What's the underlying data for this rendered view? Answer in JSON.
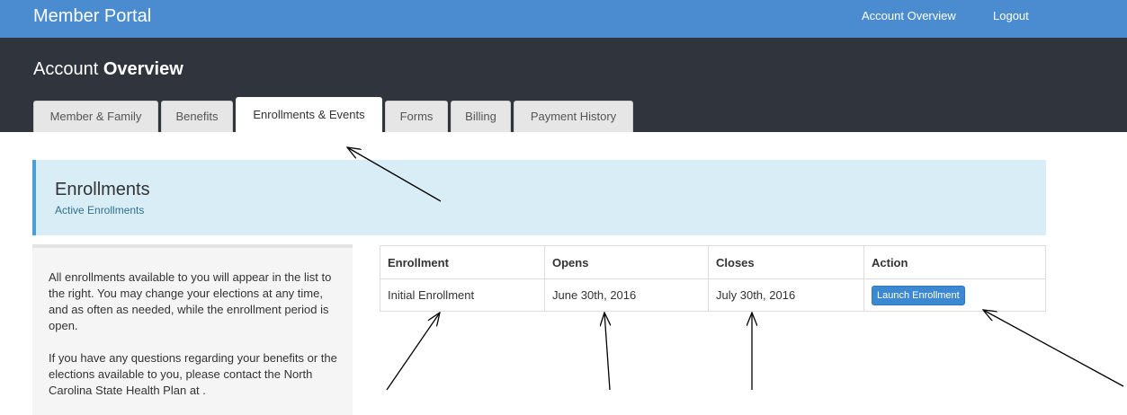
{
  "navbar": {
    "brand": "Member Portal",
    "links": [
      {
        "label": "Account Overview"
      },
      {
        "label": "Logout"
      }
    ]
  },
  "header": {
    "title_prefix": "Account",
    "title_bold": "Overview",
    "tabs": [
      {
        "label": "Member & Family",
        "active": false
      },
      {
        "label": "Benefits",
        "active": false
      },
      {
        "label": "Enrollments & Events",
        "active": true
      },
      {
        "label": "Forms",
        "active": false
      },
      {
        "label": "Billing",
        "active": false
      },
      {
        "label": "Payment History",
        "active": false
      }
    ]
  },
  "section": {
    "title": "Enrollments",
    "subtitle": "Active Enrollments"
  },
  "sidebar": {
    "paragraph1": "All enrollments available to you will appear in the list to the right. You may change your elections at any time, and as often as needed, while the enrollment period is open.",
    "paragraph2": "If you have any questions regarding your benefits or the elections available to you, please contact the North Carolina State Health Plan at ."
  },
  "table": {
    "headers": [
      "Enrollment",
      "Opens",
      "Closes",
      "Action"
    ],
    "rows": [
      {
        "enrollment": "Initial Enrollment",
        "opens": "June 30th, 2016",
        "closes": "July 30th, 2016",
        "action": "Launch Enrollment"
      }
    ]
  },
  "colors": {
    "navbar": "#4a8ccf",
    "header": "#30353d",
    "callout_bg": "#d9edf7",
    "callout_border": "#4a9fd6",
    "button": "#3c88d1"
  }
}
